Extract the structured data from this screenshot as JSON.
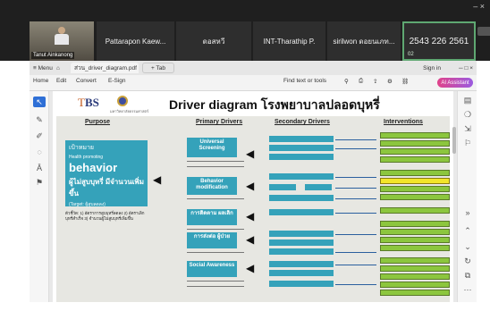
{
  "meeting": {
    "participants": [
      {
        "name": "Tanut Ainkanong"
      },
      {
        "name": "Pattarapon Kaew..."
      },
      {
        "name": "ดอสหวี"
      },
      {
        "name": "INT-Tharathip P."
      },
      {
        "name": "sirilwon ดอยนเภท..."
      },
      {
        "name": "2543 226 2561",
        "sub": "02"
      }
    ],
    "window_controls": "–  ×",
    "side_label": "▲"
  },
  "browser": {
    "menu_label": "≡ Menu",
    "home_icon": "home-icon",
    "tab_title": "ส่วน_driver_diagram.pdf",
    "new_tab_label": "+ Tab",
    "signin_label": "Sign in",
    "window_controls": "─  □  ×",
    "toolbar": {
      "home": "Home",
      "edit": "Edit",
      "convert": "Convert",
      "sign": "E-Sign",
      "find": "Find text or tools",
      "ai_label": "AI Assistant"
    }
  },
  "slide": {
    "logo_text_a": "T",
    "logo_text_b": "BS",
    "logo_caption": "มหาวิทยาลัยธรรมศาสตร์",
    "title": "Driver diagram โรงพยาบาลปลอดบุหรี่",
    "headers": {
      "purpose": "Purpose",
      "primary": "Primary Drivers",
      "secondary": "Secondary Drivers",
      "interventions": "Interventions"
    },
    "aim": {
      "l1": "เป้าหมาย",
      "l2": "Health promoting",
      "l3": "behavior",
      "l4": "ผู้ไม่สูบบุหรี่ มีจำนวนเพิ่มขึ้น",
      "l5": "(Target: ผู้สูบลดลง)"
    },
    "indicator": "ตัวชี้วัด: 1) อัตราการสูบบุหรี่ลดลง 2) อัตราเลิกบุหรี่สำเร็จ 3) จำนวนผู้ไม่สูบบุหรี่เพิ่มขึ้น",
    "primary_drivers": [
      "Universal Screening",
      "Behavior modification",
      "การติดตาม ผลเลิก",
      "การส่งต่อ ผู้ป่วย",
      "Social Awareness"
    ]
  }
}
